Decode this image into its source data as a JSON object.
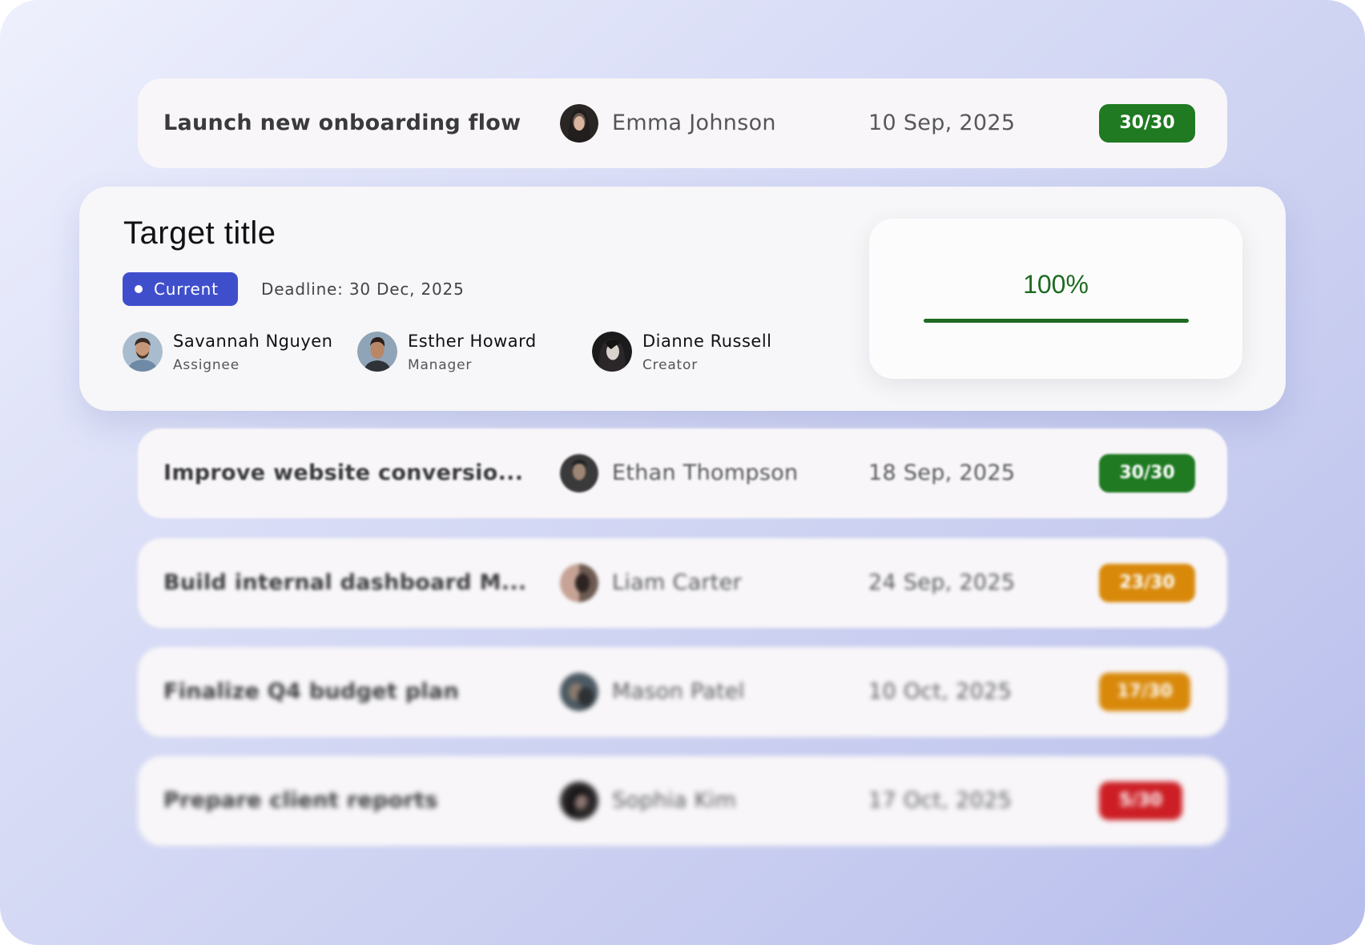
{
  "colors": {
    "score_green": "#1f7a22",
    "score_orange": "#d9890a",
    "score_red": "#cc1e24",
    "current_badge": "#3f4fcc",
    "progress": "#1f6b22"
  },
  "tasks_above": [
    {
      "title": "Launch new onboarding flow",
      "person": "Emma Johnson",
      "date": "10 Sep, 2025",
      "score": "30/30",
      "score_status": "green"
    }
  ],
  "selected": {
    "title": "Target title",
    "status": "Current",
    "deadline_label": "Deadline:",
    "deadline_value": "30 Dec, 2025",
    "members": [
      {
        "name": "Savannah Nguyen",
        "role": "Assignee"
      },
      {
        "name": "Esther Howard",
        "role": "Manager"
      },
      {
        "name": "Dianne Russell",
        "role": "Creator"
      }
    ],
    "progress_label": "100%",
    "progress_fraction": 1.0
  },
  "tasks_below": [
    {
      "title": "Improve website conversio...",
      "person": "Ethan Thompson",
      "date": "18 Sep, 2025",
      "score": "30/30",
      "score_status": "green"
    },
    {
      "title": "Build internal dashboard M...",
      "person": "Liam Carter",
      "date": "24 Sep, 2025",
      "score": "23/30",
      "score_status": "orange"
    },
    {
      "title": "Finalize Q4 budget plan",
      "person": "Mason Patel",
      "date": "10 Oct, 2025",
      "score": "17/30",
      "score_status": "orange"
    },
    {
      "title": "Prepare client reports",
      "person": "Sophia Kim",
      "date": "17 Oct, 2025",
      "score": "5/30",
      "score_status": "red"
    }
  ]
}
